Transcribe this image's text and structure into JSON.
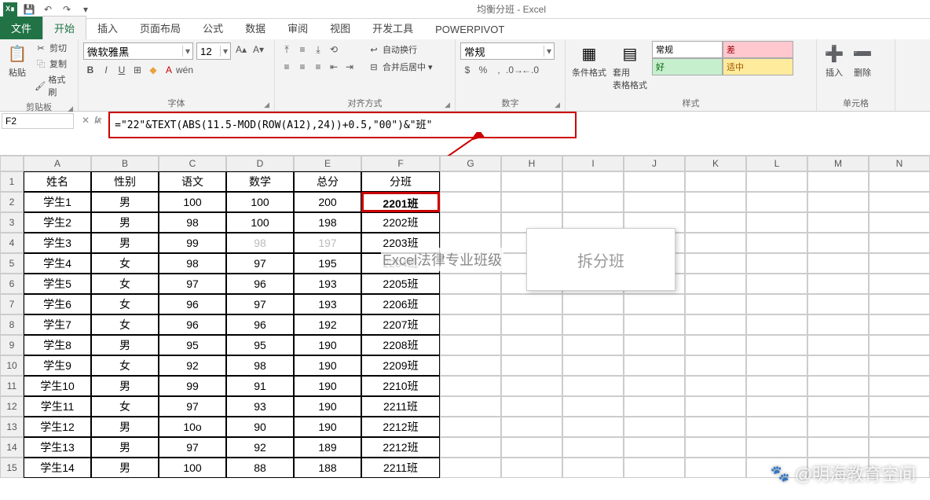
{
  "title": "均衡分班 - Excel",
  "qat": {
    "save": "💾",
    "undo": "↶",
    "redo": "↷"
  },
  "tabs": {
    "file": "文件",
    "home": "开始",
    "insert": "插入",
    "layout": "页面布局",
    "formulas": "公式",
    "data": "数据",
    "review": "审阅",
    "view": "视图",
    "dev": "开发工具",
    "pp": "POWERPIVOT"
  },
  "ribbon": {
    "clipboard": {
      "label": "剪贴板",
      "paste": "粘贴",
      "cut": "剪切",
      "copy": "复制",
      "fmtp": "格式刷"
    },
    "font": {
      "label": "字体",
      "name": "微软雅黑",
      "size": "12"
    },
    "align": {
      "label": "对齐方式",
      "wrap": "自动换行",
      "merge": "合并后居中"
    },
    "number": {
      "label": "数字",
      "fmt": "常规"
    },
    "styles": {
      "label": "样式",
      "cond": "条件格式",
      "table": "套用\n表格格式",
      "normal": "常规",
      "bad": "差",
      "good": "好",
      "neutral": "适中"
    },
    "cells": {
      "label": "单元格",
      "insert": "插入",
      "delete": "删除"
    }
  },
  "namebox": "F2",
  "formula": "=\"22\"&TEXT(ABS(11.5-MOD(ROW(A12),24))+0.5,\"00\")&\"班\"",
  "cols": [
    "A",
    "B",
    "C",
    "D",
    "E",
    "F",
    "G",
    "H",
    "I",
    "J",
    "K",
    "L",
    "M",
    "N"
  ],
  "headers": {
    "A": "姓名",
    "B": "性别",
    "C": "语文",
    "D": "数学",
    "E": "总分",
    "F": "分班"
  },
  "rows": [
    {
      "n": "学生1",
      "s": "男",
      "c": "100",
      "m": "100",
      "t": "200",
      "f": "2201班"
    },
    {
      "n": "学生2",
      "s": "男",
      "c": "98",
      "m": "100",
      "t": "198",
      "f": "2202班"
    },
    {
      "n": "学生3",
      "s": "男",
      "c": "99",
      "m": "98",
      "t": "197",
      "f": "2203班",
      "faded": true
    },
    {
      "n": "学生4",
      "s": "女",
      "c": "98",
      "m": "97",
      "t": "195",
      "f": "2204班"
    },
    {
      "n": "学生5",
      "s": "女",
      "c": "97",
      "m": "96",
      "t": "193",
      "f": "2205班"
    },
    {
      "n": "学生6",
      "s": "女",
      "c": "96",
      "m": "97",
      "t": "193",
      "f": "2206班"
    },
    {
      "n": "学生7",
      "s": "女",
      "c": "96",
      "m": "96",
      "t": "192",
      "f": "2207班"
    },
    {
      "n": "学生8",
      "s": "男",
      "c": "95",
      "m": "95",
      "t": "190",
      "f": "2208班"
    },
    {
      "n": "学生9",
      "s": "女",
      "c": "92",
      "m": "98",
      "t": "190",
      "f": "2209班"
    },
    {
      "n": "学生10",
      "s": "男",
      "c": "99",
      "m": "91",
      "t": "190",
      "f": "2210班"
    },
    {
      "n": "学生11",
      "s": "女",
      "c": "97",
      "m": "93",
      "t": "190",
      "f": "2211班"
    },
    {
      "n": "学生12",
      "s": "男",
      "c": "10o",
      "m": "90",
      "t": "190",
      "f": "2212班"
    },
    {
      "n": "学生13",
      "s": "男",
      "c": "97",
      "m": "92",
      "t": "189",
      "f": "2212班"
    },
    {
      "n": "学生14",
      "s": "男",
      "c": "100",
      "m": "88",
      "t": "188",
      "f": "2211班"
    }
  ],
  "overlay1": "Excel法律专业班级",
  "overlay2": "拆分班",
  "watermark": "@明海教育空间"
}
